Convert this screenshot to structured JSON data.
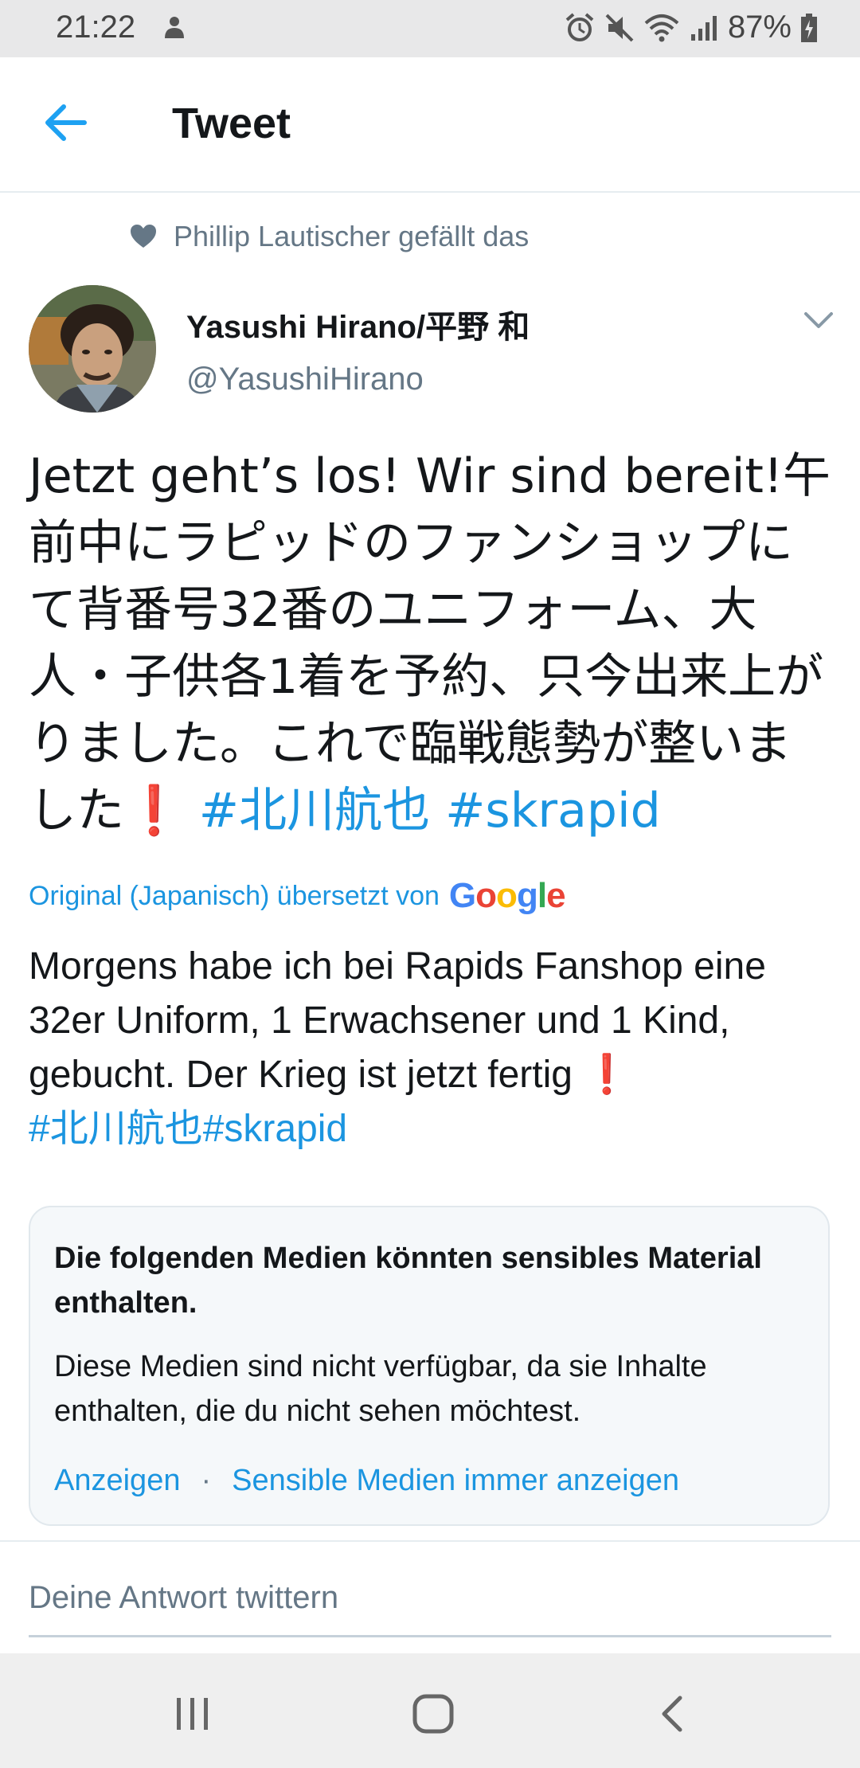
{
  "status_bar": {
    "time": "21:22",
    "battery": "87%"
  },
  "header": {
    "title": "Tweet"
  },
  "social_context": "Phillip Lautischer gefällt das",
  "author": {
    "name": "Yasushi Hirano/平野 和",
    "handle": "@YasushiHirano"
  },
  "tweet": {
    "text_main": "Jetzt geht’s los! Wir sind bereit!午前中にラピッドのファンショップにて背番号32番のユニフォーム、大人・子供各1着を予約、只今出来上がりました。これで臨戦態勢が整いました",
    "exclamation": "❗",
    "hashtag_1": "#北川航也",
    "hashtag_2": "#skrapid"
  },
  "translation_note": {
    "text": "Original (Japanisch) übersetzt von",
    "provider": "Google"
  },
  "translation": {
    "text": "Morgens habe ich bei Rapids Fanshop eine 32er Uniform, 1 Erwachsener und 1 Kind, gebucht. Der Krieg ist jetzt fertig",
    "exclamation": "❗",
    "hashtags": "#北川航也#skrapid"
  },
  "sensitive_media": {
    "title": "Die folgenden Medien könnten sensibles Material enthalten.",
    "description": "Diese Medien sind nicht verfügbar, da sie Inhalte enthalten, die du nicht sehen möchtest.",
    "show_label": "Anzeigen",
    "separator": "·",
    "always_show_label": "Sensible Medien immer anzeigen"
  },
  "reply": {
    "placeholder": "Deine Antwort twittern"
  },
  "colors": {
    "accent": "#1b95e0",
    "text_secondary": "#657786",
    "exclamation": "#c4161c"
  }
}
